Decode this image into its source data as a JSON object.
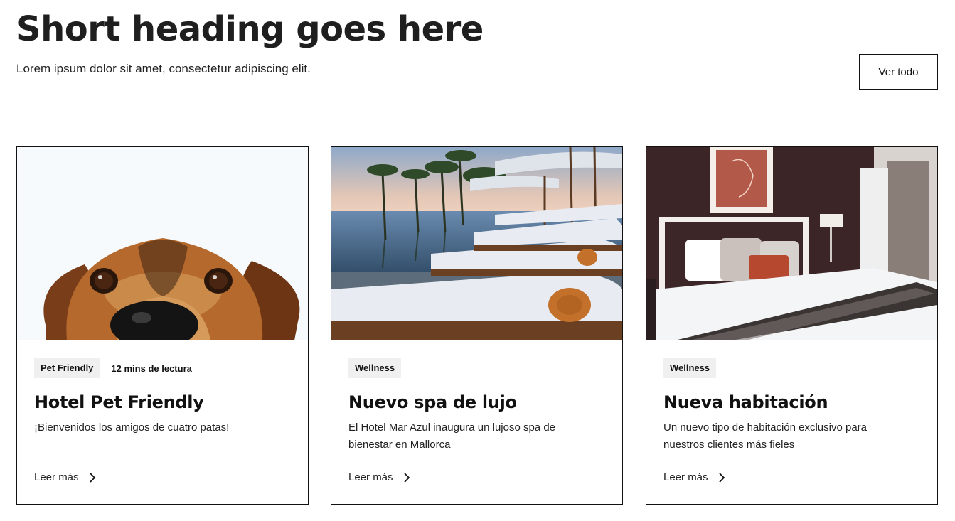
{
  "header": {
    "title": "Short heading goes here",
    "subtitle": "Lorem ipsum dolor sit amet, consectetur adipiscing elit.",
    "view_all_label": "Ver todo"
  },
  "cards": [
    {
      "image": "dog-peeking-photo",
      "tag": "Pet Friendly",
      "read_time": "12 mins de lectura",
      "title": "Hotel Pet Friendly",
      "description": "¡Bienvenidos los amigos de cuatro patas!",
      "link_label": "Leer más"
    },
    {
      "image": "poolside-loungers-photo",
      "tag": "Wellness",
      "read_time": "",
      "title": "Nuevo spa de lujo",
      "description": "El Hotel Mar Azul inaugura un lujoso spa de bienestar en Mallorca",
      "link_label": "Leer más"
    },
    {
      "image": "hotel-bedroom-photo",
      "tag": "Wellness",
      "read_time": "",
      "title": "Nueva habitación",
      "description": "Un nuevo tipo de habitación exclusivo para nuestros clientes más fieles",
      "link_label": "Leer más"
    }
  ],
  "colors": {
    "text": "#111111",
    "tag_background": "#f0f0f0",
    "border": "#111111"
  }
}
